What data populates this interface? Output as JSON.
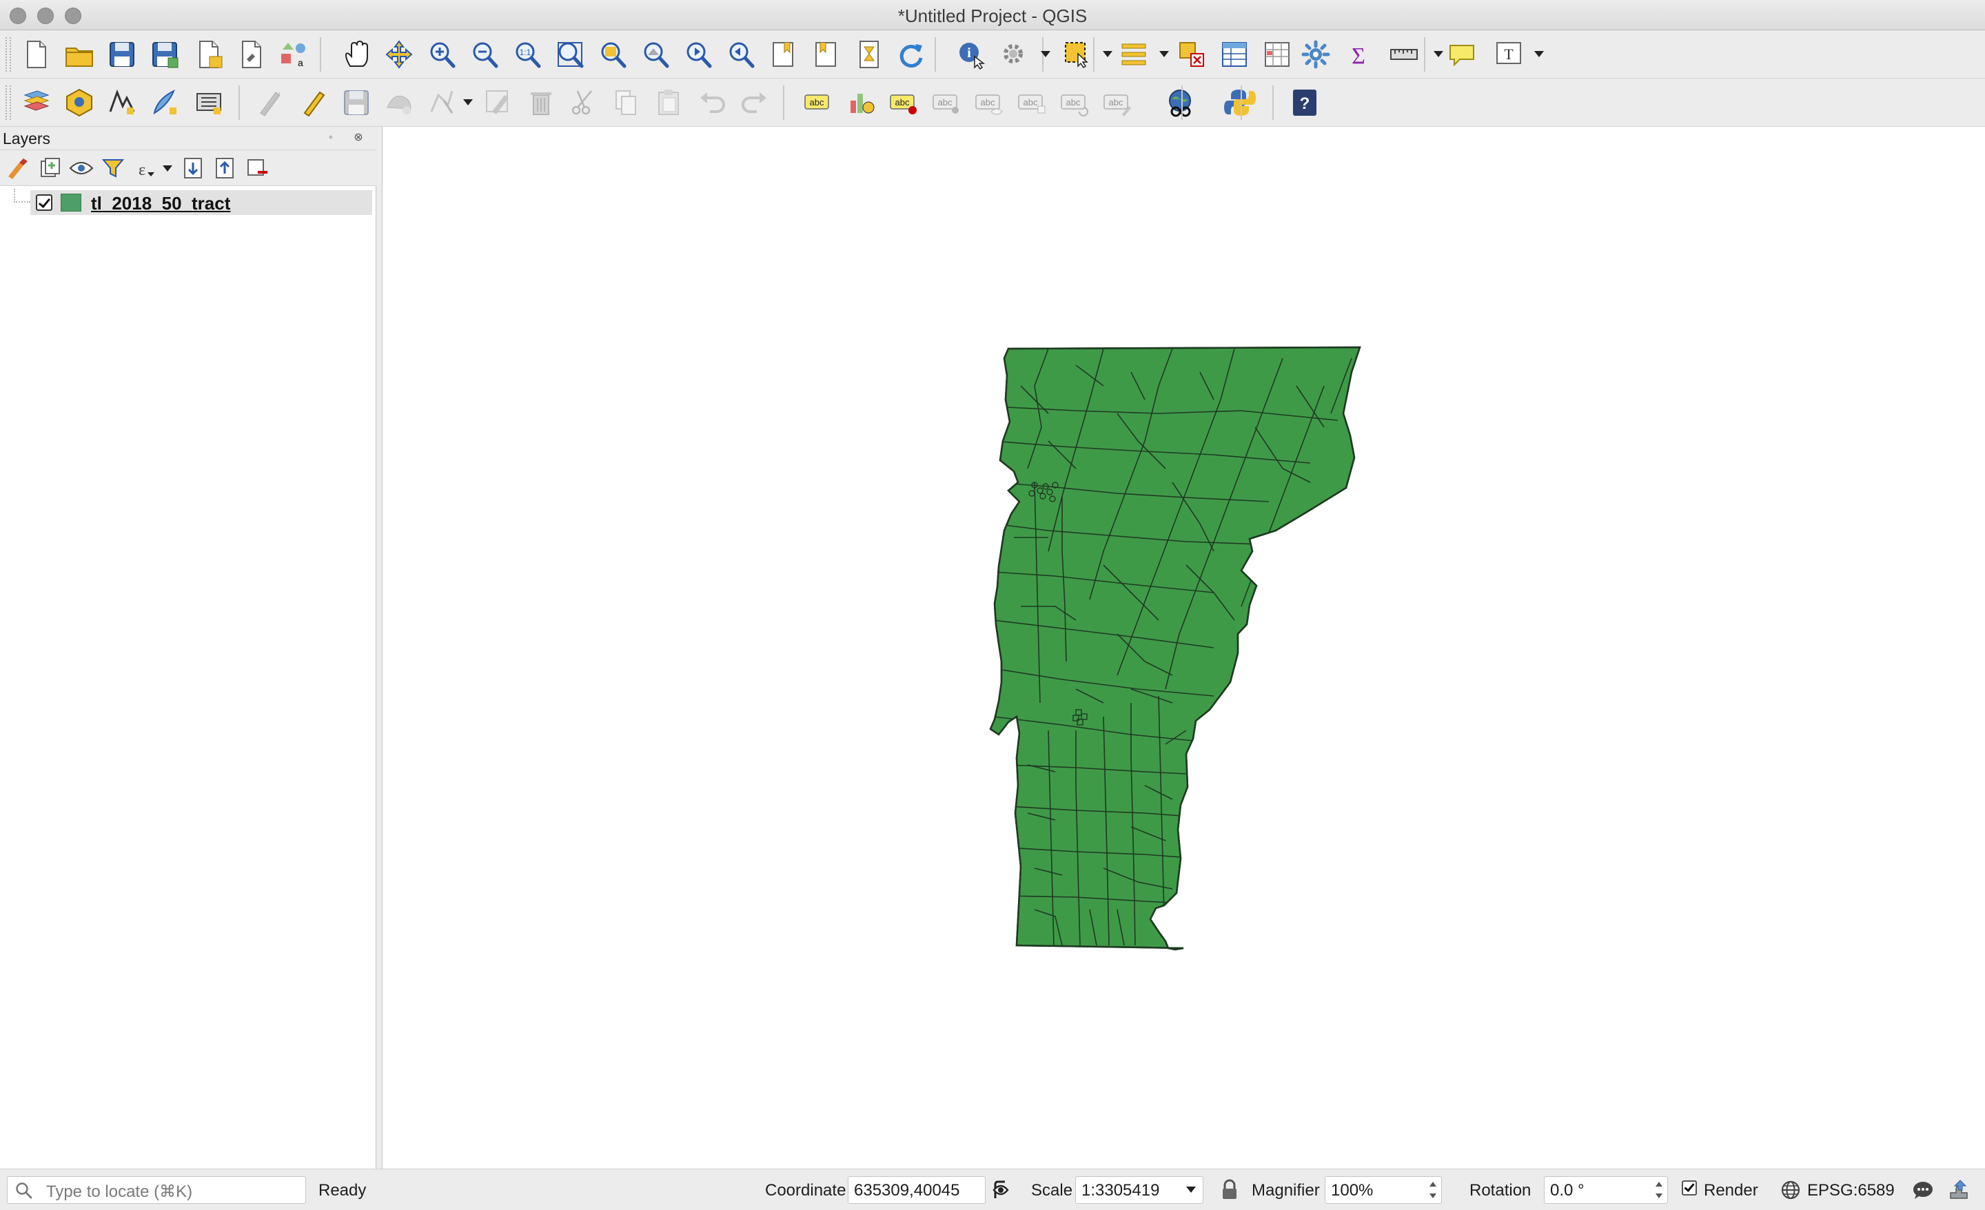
{
  "window": {
    "title": "*Untitled Project - QGIS"
  },
  "colors": {
    "layer_fill": "#3f9a48",
    "layer_stroke": "#1f3a22",
    "swatch": "#4d9e67"
  },
  "toolbar_main": {
    "icons": [
      "new-project-icon",
      "open-project-icon",
      "save-project-icon",
      "save-as-icon",
      "new-print-layout-icon",
      "layout-manager-icon",
      "style-manager-icon",
      "pan-icon",
      "pan-to-selection-icon",
      "zoom-in-icon",
      "zoom-out-icon",
      "zoom-native-icon",
      "zoom-full-icon",
      "zoom-to-selection-icon",
      "zoom-to-layer-icon",
      "zoom-last-icon",
      "zoom-next-icon",
      "new-bookmark-icon",
      "show-bookmarks-icon",
      "temporal-controller-icon",
      "refresh-icon",
      "identify-icon",
      "run-action-icon",
      "select-features-icon",
      "select-by-value-icon",
      "deselect-icon",
      "attribute-table-icon",
      "field-calculator-icon",
      "processing-toolbox-icon",
      "statistics-icon",
      "measure-icon",
      "map-tips-icon",
      "text-annotation-icon"
    ]
  },
  "toolbar_edit": {
    "icons": [
      "data-source-manager-icon",
      "new-geopackage-layer-icon",
      "new-shapefile-layer-icon",
      "new-temporary-layer-icon",
      "new-virtual-layer-icon",
      "current-edits-icon",
      "toggle-editing-icon",
      "save-edits-icon",
      "add-feature-icon",
      "vertex-tool-icon",
      "modify-attributes-icon",
      "delete-selected-icon",
      "cut-features-icon",
      "copy-features-icon",
      "paste-features-icon",
      "undo-icon",
      "redo-icon",
      "label-tool-icon",
      "diagram-tool-icon",
      "pin-labels-icon",
      "highlight-pinned-icon",
      "show-hide-labels-icon",
      "move-label-icon",
      "rotate-label-icon",
      "change-label-icon",
      "metasearch-icon",
      "python-console-icon",
      "help-icon"
    ]
  },
  "layers_panel": {
    "title": "Layers",
    "tools": [
      "style-panel-icon",
      "add-group-icon",
      "manage-visibility-icon",
      "filter-legend-icon",
      "filter-by-expression-icon",
      "expand-all-icon",
      "collapse-all-icon",
      "remove-layer-icon"
    ],
    "layers": [
      {
        "name": "tl_2018_50_tract",
        "visible": true
      }
    ]
  },
  "statusbar": {
    "locator_placeholder": "Type to locate (⌘K)",
    "status": "Ready",
    "coordinate_label": "Coordinate",
    "coordinate_value": "635309,40045",
    "scale_label": "Scale",
    "scale_value": "1:3305419",
    "magnifier_label": "Magnifier",
    "magnifier_value": "100%",
    "rotation_label": "Rotation",
    "rotation_value": "0.0 °",
    "render_label": "Render",
    "render_checked": true,
    "crs": "EPSG:6589"
  }
}
